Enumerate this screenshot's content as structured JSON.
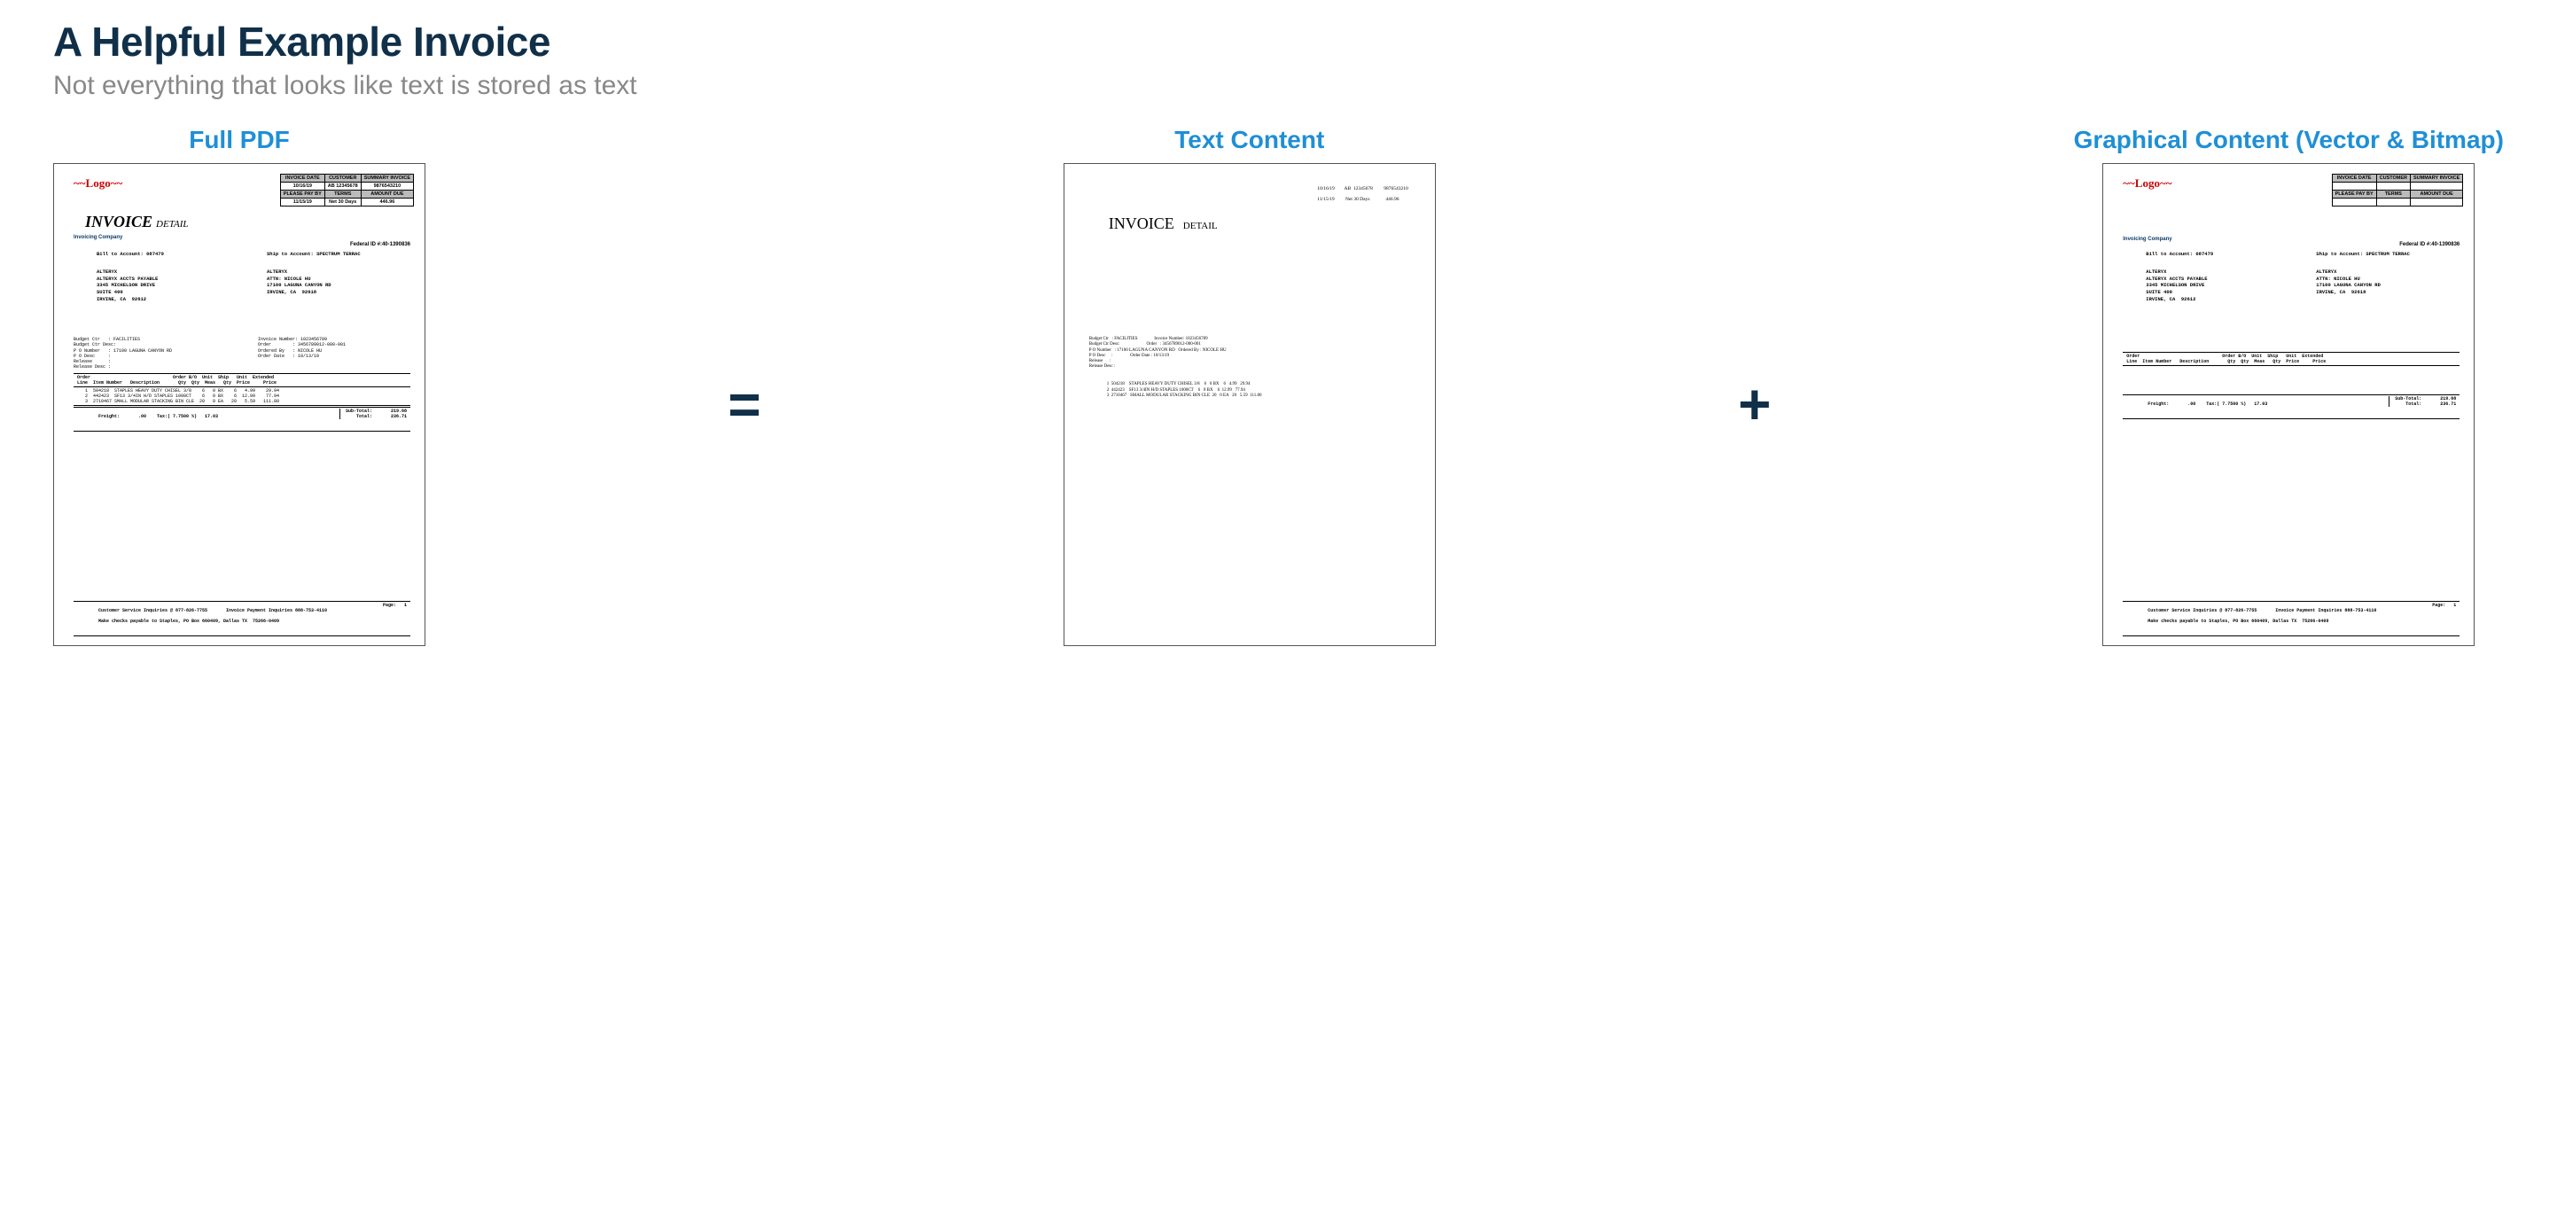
{
  "heading": {
    "title": "A Helpful Example Invoice",
    "subtitle": "Not everything that looks like text is stored as text"
  },
  "columns": {
    "full": "Full PDF",
    "text": "Text Content",
    "graphical": "Graphical Content (Vector & Bitmap)"
  },
  "ops": {
    "eq": "=",
    "plus": "+"
  },
  "invoice": {
    "logo": "~~Logo~~",
    "big_title": "INVOICE",
    "big_detail": "DETAIL",
    "company": "Invoicing Company",
    "federal_id": "Federal ID #:40-1390836",
    "header_table": {
      "r1": [
        "INVOICE DATE",
        "CUSTOMER",
        "SUMMARY INVOICE"
      ],
      "r2": [
        "10/16/19",
        "AB  12345678",
        "9876543210"
      ],
      "r3": [
        "PLEASE PAY BY",
        "TERMS",
        "AMOUNT DUE"
      ],
      "r4": [
        "11/15/19",
        "Net 30 Days",
        "446.96"
      ]
    },
    "bill_label": "Bill to Account: 087479",
    "ship_label": "Ship to Account: SPECTRUM TERRAC",
    "bill_addr": "ALTERYX\nALTERYX ACCTS PAYABLE\n3345 MICHELSON DRIVE\nSUITE 400\nIRVINE, CA  92612",
    "ship_addr": "ALTERYX\nATTN: NICOLE HU\n17100 LAGUNA CANYON RD\nIRVINE, CA  92618",
    "meta_left": "Budget Ctr   : FACILITIES\nBudget Ctr Desc:\nP O Number   : 17100 LAGUNA CANYON RD\nP O Desc     :\nRelease      :\nRelease Desc :",
    "meta_right": "Invoice Number: 1023456789\nOrder        : 3456789012-000-001\nOrdered By   : NICOLE HU\nOrder Date   : 10/13/19",
    "line_header": "Order                               Order B/O  Unit  Ship   Unit  Extended\nLine  Item Number   Description       Qty  Qty  Meas   Qty  Price     Price",
    "lines": "   1  504218  STAPLES HEAVY DUTY CHISEL 3/8    6   0 BX    6   4.99    29.94\n   2  442423  SF13 3/4IN H/D STAPLES 1000CT    6   0 BX    6  12.99    77.94\n   3  2710467 SMALL MODULAR STACKING BIN CLE  20   0 EA   20   5.59   111.80",
    "totals_left": "Freight:       .00    Tax:( 7.7500 %)   17.03",
    "totals_right": "Sub-Total:       219.68\n    Total:       236.71",
    "footer1": "Customer Service Inquiries @ 877-826-7755       Invoice Payment Inquiries 888-753-4110",
    "footer2": "Make checks payable to Staples, PO Box 660409, Dallas TX  75266-0409",
    "page_label": "Page:   1"
  },
  "text_only": {
    "hdr": "10/16/19        AB  12345678         9876543210\n\n11/15/19         Net 30 Days             446.96",
    "meta": "Budget Ctr   : FACILITIES               Invoice Number: 1023456789\nBudget Ctr Desc:                        Order   : 3456789012-000-001\nP O Number   : 17100 LAGUNA CANYON RD   Ordered By : NICOLE HU\nP O Desc     :                Order Date : 10/13/19\nRelease      :\nRelease Desc :",
    "lines": "1  504218    STAPLES HEAVY DUTY CHISEL 3/8    6   0 BX    6   4.99   29.94\n2  442423    SF13 3/4IN H/D STAPLES 1000CT    6   0 BX    6  12.99   77.94\n3  2710467   SMALL MODULAR STACKING BIN CLE  20   0 EA   20   5.59  111.80"
  }
}
